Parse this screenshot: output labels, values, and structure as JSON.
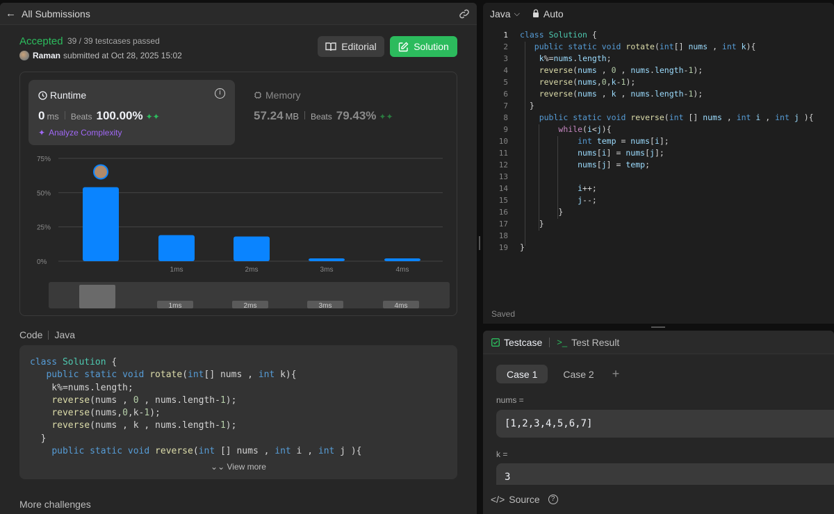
{
  "left_header": {
    "back_label": "All Submissions"
  },
  "submission": {
    "status": "Accepted",
    "testcases": "39 / 39 testcases passed",
    "user": "Raman",
    "submitted_text": "submitted at Oct 28, 2025 15:02"
  },
  "buttons": {
    "editorial": "Editorial",
    "solution": "Solution"
  },
  "runtime": {
    "title": "Runtime",
    "value": "0",
    "unit": "ms",
    "beats_label": "Beats",
    "beats": "100.00%",
    "analyze": "Analyze Complexity"
  },
  "memory": {
    "title": "Memory",
    "value": "57.24",
    "unit": "MB",
    "beats_label": "Beats",
    "beats": "79.43%"
  },
  "chart_data": {
    "type": "bar",
    "categories": [
      "",
      "1ms",
      "2ms",
      "3ms",
      "4ms"
    ],
    "values": [
      54,
      19,
      18,
      2,
      2
    ],
    "ylabel": "",
    "yticks": [
      "75%",
      "50%",
      "25%",
      "0%"
    ],
    "ytick_values": [
      75,
      50,
      25,
      0
    ],
    "ylim": [
      0,
      75
    ],
    "grid": true,
    "user_marker_category": 0,
    "bar_color": "#0a84ff",
    "navigator_labels": [
      "1ms",
      "2ms",
      "3ms",
      "4ms"
    ]
  },
  "code_section": {
    "label": "Code",
    "language": "Java",
    "view_more": "View more"
  },
  "more_challenges": "More challenges",
  "editor": {
    "language": "Java",
    "mode": "Auto",
    "saved": "Saved",
    "line_count": 19
  },
  "testcase_panel": {
    "tab_testcase": "Testcase",
    "tab_result": "Test Result",
    "cases": [
      "Case 1",
      "Case 2"
    ],
    "inputs": [
      {
        "name": "nums =",
        "value": "[1,2,3,4,5,6,7]"
      },
      {
        "name": "k =",
        "value": "3"
      }
    ],
    "source": "Source"
  }
}
